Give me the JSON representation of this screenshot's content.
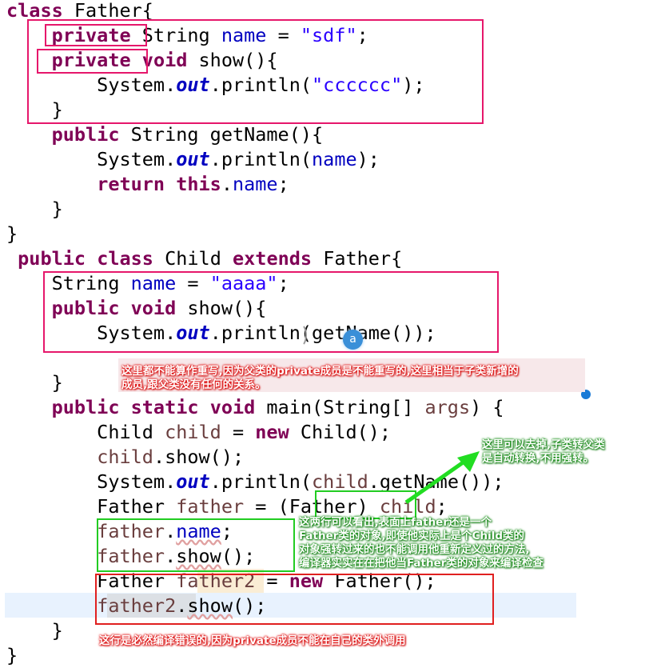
{
  "code_lines": [
    "class Father{",
    "    private String name = \"sdf\";",
    "    private void show(){",
    "        System.out.println(\"cccccc\");",
    "    }",
    "    public String getName(){",
    "        System.out.println(name);",
    "        return this.name;",
    "    }",
    "}",
    " public class Child extends Father{",
    "    String name = \"aaaa\";",
    "    public void show(){",
    "        System.out.println(getName());",
    "    }",
    "    public static void main(String[] args) {",
    "        Child child = new Child();",
    "        child.show();",
    "        System.out.println(child.getName());",
    "        Father father = (Father) child;",
    "        father.name;",
    "        father.show();",
    "        Father father2 = new Father();",
    "        father2.show();",
    "    }",
    "}"
  ],
  "annotations": {
    "override_note_line1": "这里都不能算作重写,因为父类的private成员是不能重写的,这里相当于子类新增的",
    "override_note_line2": "成员,跟父类没有任何的关系。",
    "cast_note_line1": "这里可以去掉,子类转父类",
    "cast_note_line2": "是自动转换,不用强转。",
    "father_note_line1": "这两行可以看出,表面上father还是一个",
    "father_note_line2": "Father类的对象,即使他实际上是个Child类的",
    "father_note_line3": "对象强转过来的也不能调用他重新定义过的方法,",
    "father_note_line4": "编译器实实在在把他当Father类的对象来编译检查",
    "compile_error_note": "这行是必然编译错误的,因为private成员不能在自己的类外调用"
  },
  "badge_label": "a",
  "colors": {
    "keyword": "#7f0055",
    "string": "#2a00ff",
    "field": "#0000c0",
    "annotation_box": "#e6176b",
    "green_box": "#22cc22",
    "red_box": "#e02020"
  }
}
